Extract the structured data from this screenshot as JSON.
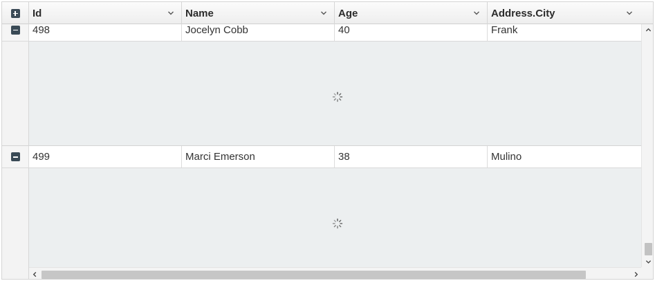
{
  "columns": {
    "expand_all_icon": "plus-square-icon",
    "id": "Id",
    "name": "Name",
    "age": "Age",
    "city": "Address.City"
  },
  "rows": [
    {
      "id": "498",
      "name": "Jocelyn Cobb",
      "age": "40",
      "city": "Frank",
      "expanded": true
    },
    {
      "id": "499",
      "name": "Marci Emerson",
      "age": "38",
      "city": "Mulino",
      "expanded": true
    }
  ],
  "colors": {
    "header_bg": "#f2f2f2",
    "detail_bg": "#eceff0",
    "toggle": "#3a4a56",
    "scroll_thumb": "#c2c2c2"
  }
}
